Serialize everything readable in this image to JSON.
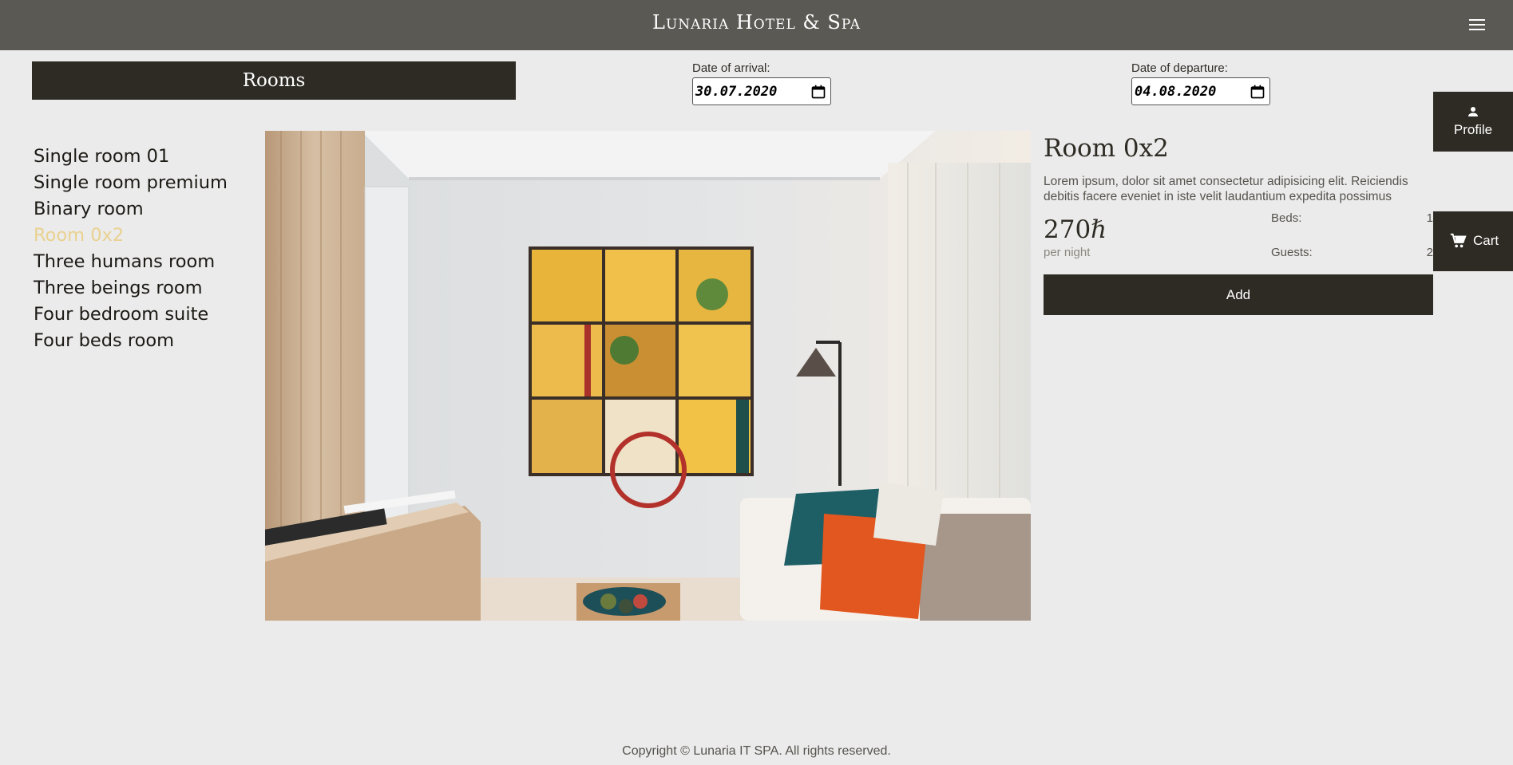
{
  "header": {
    "brand": "Lunaria Hotel & Spa",
    "menu_icon": "menu-icon"
  },
  "rooms_panel": {
    "title": "Rooms"
  },
  "dates": {
    "arrival_label": "Date of arrival:",
    "arrival_value": "30.07.2020",
    "departure_label": "Date of departure:",
    "departure_value": "04.08.2020"
  },
  "room_list": [
    {
      "label": "Single room 01"
    },
    {
      "label": "Single room premium"
    },
    {
      "label": "Binary room"
    },
    {
      "label": "Room 0x2",
      "active": true
    },
    {
      "label": "Three humans room"
    },
    {
      "label": "Three beings room"
    },
    {
      "label": "Four bedroom suite"
    },
    {
      "label": "Four beds room"
    }
  ],
  "room_detail": {
    "title": "Room 0x2",
    "description": "Lorem ipsum, dolor sit amet consectetur adipisicing elit. Reiciendis debitis facere eveniet in iste velit laudantium expedita possimus",
    "price": "270ℏ",
    "price_unit": "per night",
    "beds_label": "Beds:",
    "beds_value": "1",
    "guests_label": "Guests:",
    "guests_value": "2",
    "add_label": "Add"
  },
  "side_actions": {
    "profile_label": "Profile",
    "cart_label": "Cart"
  },
  "footer": {
    "copyright": "Copyright © Lunaria IT SPA. All rights reserved."
  },
  "colors": {
    "topbar": "#5b5954",
    "dark": "#2e2b24",
    "accent_active": "#e9d18f",
    "background": "#ebebeb"
  }
}
